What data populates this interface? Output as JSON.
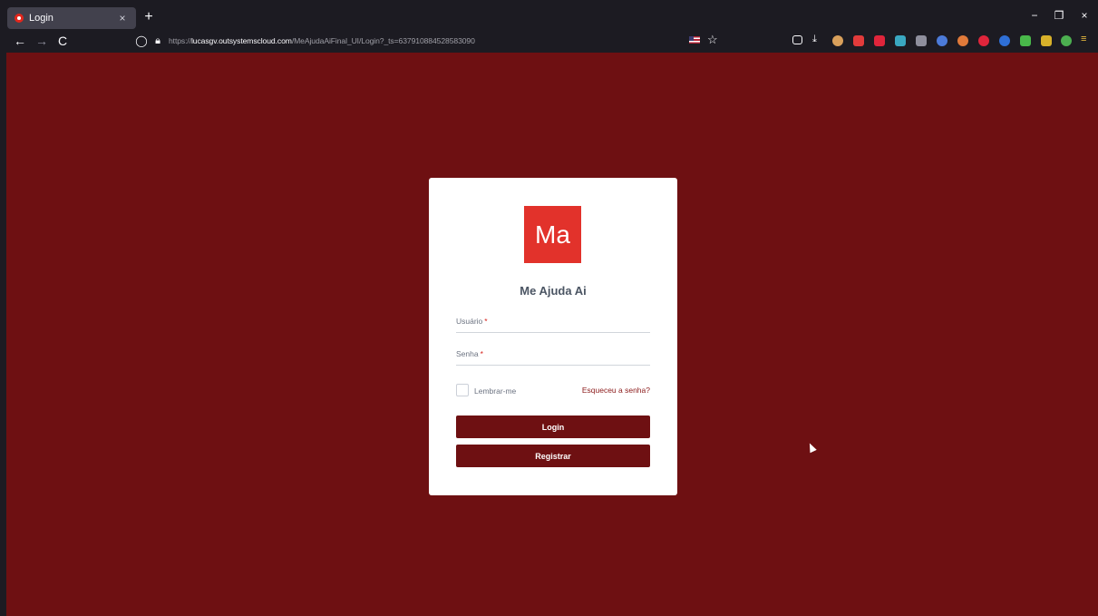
{
  "browser": {
    "tab": {
      "title": "Login",
      "close_glyph": "×"
    },
    "new_tab_glyph": "+",
    "window_controls": {
      "minimize": "−",
      "restore": "❐",
      "close": "×"
    },
    "nav": {
      "back": "←",
      "forward": "→",
      "reload": "C"
    },
    "url": {
      "prefix": "https://",
      "host": "lucasgv.outsystemscloud.com",
      "path": "/MeAjudaAiFinal_UI/Login?_ts=637910884528583090"
    }
  },
  "login": {
    "logo_text": "Ma",
    "app_name": "Me Ajuda Ai",
    "username_label": "Usuário",
    "password_label": "Senha",
    "required_mark": "*",
    "remember_label": "Lembrar-me",
    "forgot_link": "Esqueceu a senha?",
    "login_button": "Login",
    "register_button": "Registrar"
  },
  "colors": {
    "page_background": "#6e1012",
    "logo_background": "#e2322b",
    "button_background": "#6e1012",
    "link": "#8b1a1a"
  }
}
